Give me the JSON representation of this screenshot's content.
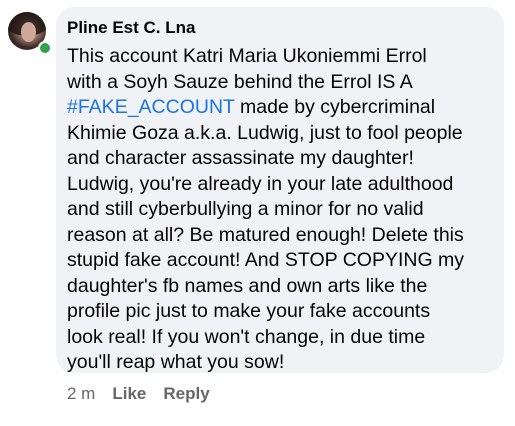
{
  "comment": {
    "author": "Pline Est C. Lna",
    "avatar_icon": "profile-photo",
    "online_status_color": "#31a24c",
    "bubble_color": "#f0f2f5",
    "hashtag_color": "#1b74e4",
    "text_lines": [
      "This account Katri Maria Ukoniemmi Errol",
      "with a Soyh Sauze behind the Errol IS A",
      "",
      "Khimie Goza a.k.a. Ludwig, just to fool people",
      "and character assassinate my daughter!",
      "Ludwig, you're already in your late adulthood",
      "and still cyberbullying a minor for no valid",
      "reason at all? Be matured enough! Delete this",
      "stupid fake account! And STOP COPYING my",
      "daughter's fb names and own arts like the",
      "profile pic just to make your fake accounts",
      "look real! If you won't change, in due time",
      "you'll reap what you sow!"
    ],
    "hashtag": "#FAKE_ACCOUNT",
    "line3_rest": " made by cybercriminal",
    "actions": {
      "time": "2 m",
      "like": "Like",
      "reply": "Reply"
    }
  }
}
